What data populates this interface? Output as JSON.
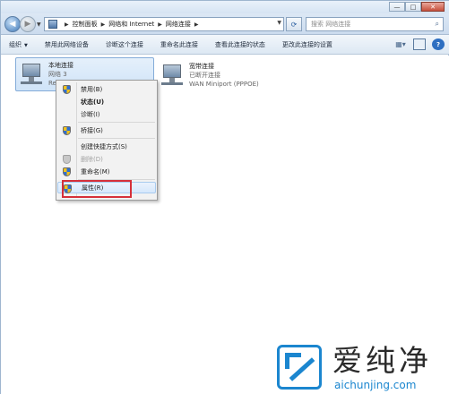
{
  "window": {
    "controls": {
      "minimize": "—",
      "maximize": "□",
      "close": "✕"
    }
  },
  "address_bar": {
    "crumbs": [
      "控制面板",
      "网络和 Internet",
      "网络连接"
    ],
    "search_placeholder": "搜索 网络连接"
  },
  "command_bar": {
    "items": [
      {
        "label": "组织",
        "dropdown": true
      },
      {
        "label": "禁用此网络设备",
        "dropdown": false
      },
      {
        "label": "诊断这个连接",
        "dropdown": false
      },
      {
        "label": "重命名此连接",
        "dropdown": false
      },
      {
        "label": "查看此连接的状态",
        "dropdown": false
      },
      {
        "label": "更改此连接的设置",
        "dropdown": false
      }
    ]
  },
  "connections": {
    "local": {
      "name": "本地连接",
      "status": "网络 3",
      "device": "Rea"
    },
    "broadband": {
      "name": "宽带连接",
      "status": "已断开连接",
      "device": "WAN Miniport (PPPOE)"
    }
  },
  "context_menu": {
    "items": [
      {
        "label": "禁用(B)",
        "icon": "shield-icon",
        "bold": false,
        "disabled": false
      },
      {
        "label": "状态(U)",
        "icon": null,
        "bold": true,
        "disabled": false
      },
      {
        "label": "诊断(I)",
        "icon": null,
        "bold": false,
        "disabled": false
      },
      {
        "label": "桥接(G)",
        "icon": "shield-icon",
        "bold": false,
        "disabled": false
      },
      {
        "label": "创建快捷方式(S)",
        "icon": null,
        "bold": false,
        "disabled": false
      },
      {
        "label": "删除(D)",
        "icon": "shield-icon",
        "bold": false,
        "disabled": true
      },
      {
        "label": "重命名(M)",
        "icon": "shield-icon",
        "bold": false,
        "disabled": false
      },
      {
        "label": "属性(R)",
        "icon": "shield-icon",
        "bold": false,
        "disabled": false,
        "highlighted": true
      }
    ]
  },
  "watermark": {
    "title": "爱纯净",
    "subtitle": "aichunjing.com"
  },
  "colors": {
    "highlight_box": "#d6303a",
    "selection": "#cfe3f8",
    "brand_blue": "#1b86cf"
  }
}
